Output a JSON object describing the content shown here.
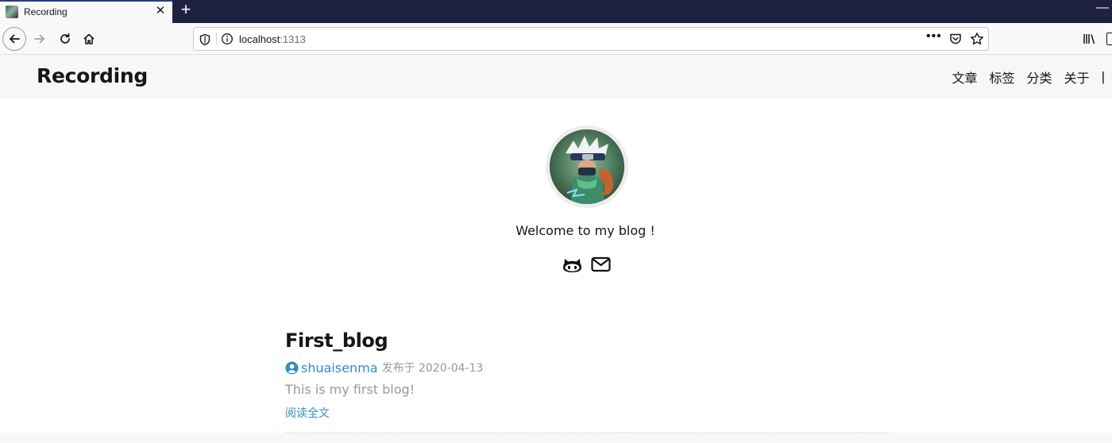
{
  "browser": {
    "tab_title": "Recording",
    "tab_close": "✕",
    "new_tab": "+",
    "window_minimize": "—",
    "url_host": "localhost",
    "url_port": ":1313",
    "url_more": "•••"
  },
  "site": {
    "logo": "Recording",
    "menu": [
      {
        "label": "文章"
      },
      {
        "label": "标签"
      },
      {
        "label": "分类"
      },
      {
        "label": "关于"
      }
    ],
    "menu_separator": "|"
  },
  "profile": {
    "welcome": "Welcome to my blog !",
    "social_icons": [
      "github-icon",
      "mail-icon"
    ]
  },
  "posts": [
    {
      "title": "First_blog",
      "author": "shuaisenma",
      "date": "发布于 2020-04-13",
      "summary": "This is my first blog!",
      "read_more": "阅读全文"
    }
  ],
  "colors": {
    "tabbar_bg": "#1f2141",
    "header_bg": "#f7f7f7",
    "link": "#2f90b9",
    "muted": "#999999"
  }
}
